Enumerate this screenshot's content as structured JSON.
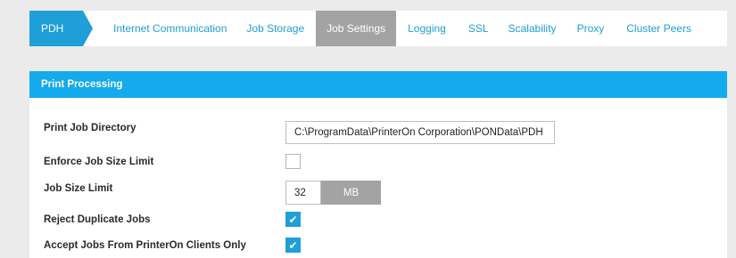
{
  "tabs": [
    {
      "label": "PDH"
    },
    {
      "label": "Internet Communication"
    },
    {
      "label": "Job Storage"
    },
    {
      "label": "Job Settings"
    },
    {
      "label": "Logging"
    },
    {
      "label": "SSL"
    },
    {
      "label": "Scalability"
    },
    {
      "label": "Proxy"
    },
    {
      "label": "Cluster Peers"
    }
  ],
  "active_tab": "Job Settings",
  "panel": {
    "title": "Print Processing",
    "fields": {
      "print_job_directory": {
        "label": "Print Job Directory",
        "value": "C:\\ProgramData\\PrinterOn Corporation\\PONData\\PDH"
      },
      "enforce_job_size_limit": {
        "label": "Enforce Job Size Limit",
        "checked": false
      },
      "job_size_limit": {
        "label": "Job Size Limit",
        "value": "32",
        "unit": "MB"
      },
      "reject_duplicate_jobs": {
        "label": "Reject Duplicate Jobs",
        "checked": true
      },
      "accept_printeron_only": {
        "label": "Accept Jobs From PrinterOn Clients Only",
        "checked": true
      }
    }
  },
  "icons": {
    "check": "check-icon"
  },
  "colors": {
    "accent": "#1e9fd8",
    "header": "#14aaeb",
    "inactive": "#a3a3a3",
    "background": "#ebebeb"
  }
}
